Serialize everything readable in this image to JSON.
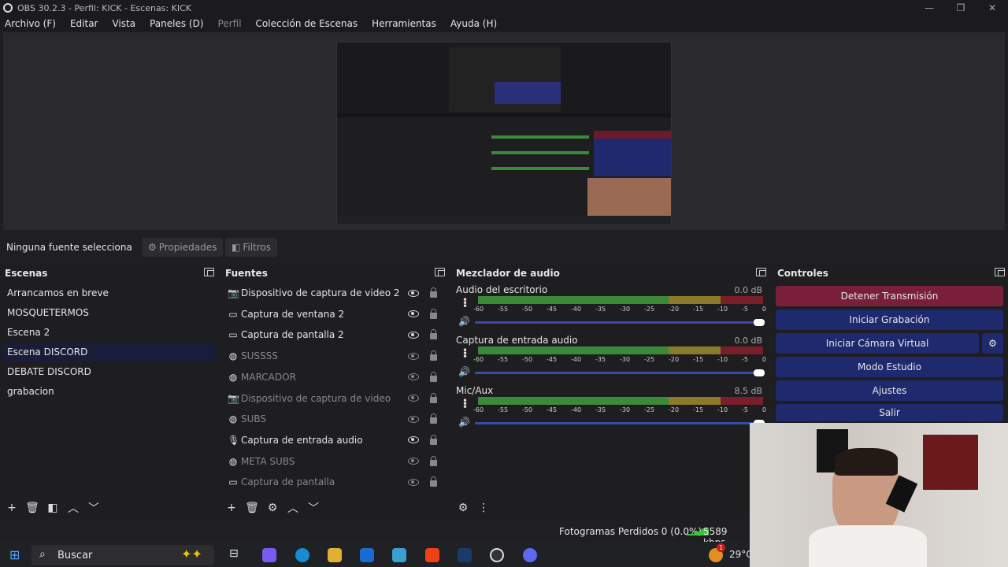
{
  "titlebar": {
    "title": "OBS 30.2.3 - Perfil: KICK - Escenas: KICK",
    "min": "—",
    "max": "❐",
    "close": "✕"
  },
  "menu": [
    "Archivo (F)",
    "Editar",
    "Vista",
    "Paneles (D)",
    "Perfil",
    "Colección de Escenas",
    "Herramientas",
    "Ayuda (H)"
  ],
  "source_toolbar": {
    "none_selected": "Ninguna fuente selecciona",
    "properties": "Propiedades",
    "filters": "Filtros"
  },
  "scenes": {
    "title": "Escenas",
    "items": [
      "Arrancamos en breve",
      "MOSQUETERMOS",
      "Escena 2",
      "Escena DISCORD",
      "DEBATE DISCORD",
      "grabacion"
    ],
    "selected": "Escena DISCORD"
  },
  "sources": {
    "title": "Fuentes",
    "items": [
      {
        "name": "Dispositivo de captura de video 2",
        "icon": "camera",
        "visible": true
      },
      {
        "name": "Captura de ventana 2",
        "icon": "window",
        "visible": true
      },
      {
        "name": "Captura de pantalla 2",
        "icon": "monitor",
        "visible": true
      },
      {
        "name": "SUSSSS",
        "icon": "globe",
        "visible": false
      },
      {
        "name": "MARCADOR",
        "icon": "globe",
        "visible": false
      },
      {
        "name": "Dispositivo de captura de video",
        "icon": "camera",
        "visible": false
      },
      {
        "name": "SUBS",
        "icon": "globe",
        "visible": false
      },
      {
        "name": "Captura de entrada audio",
        "icon": "mic",
        "visible": true
      },
      {
        "name": "META SUBS",
        "icon": "globe",
        "visible": false
      },
      {
        "name": "Captura de pantalla",
        "icon": "monitor",
        "visible": false
      }
    ]
  },
  "mixer": {
    "title": "Mezclador de audio",
    "channels": [
      {
        "name": "Audio del escritorio",
        "db": "0.0 dB"
      },
      {
        "name": "Captura de entrada audio",
        "db": "0.0 dB"
      },
      {
        "name": "Mic/Aux",
        "db": "8.5 dB"
      }
    ],
    "ticks": [
      "-60",
      "-55",
      "-50",
      "-45",
      "-40",
      "-35",
      "-30",
      "-25",
      "-20",
      "-15",
      "-10",
      "-5",
      "0"
    ]
  },
  "controls": {
    "title": "Controles",
    "buttons": [
      "Detener Transmisión",
      "Iniciar Grabación",
      "Iniciar Cámara Virtual",
      "Modo Estudio",
      "Ajustes",
      "Salir"
    ]
  },
  "status": {
    "dropped": "Fotogramas Perdidos 0 (0.0%)",
    "bitrate": "5589 kbps"
  },
  "taskbar": {
    "search": "Buscar",
    "temp": "29°C",
    "notif": "1"
  },
  "colors": {
    "stop": "#7a1f3a",
    "blue": "#1f2a6e",
    "accent": "#2b3a9a"
  }
}
